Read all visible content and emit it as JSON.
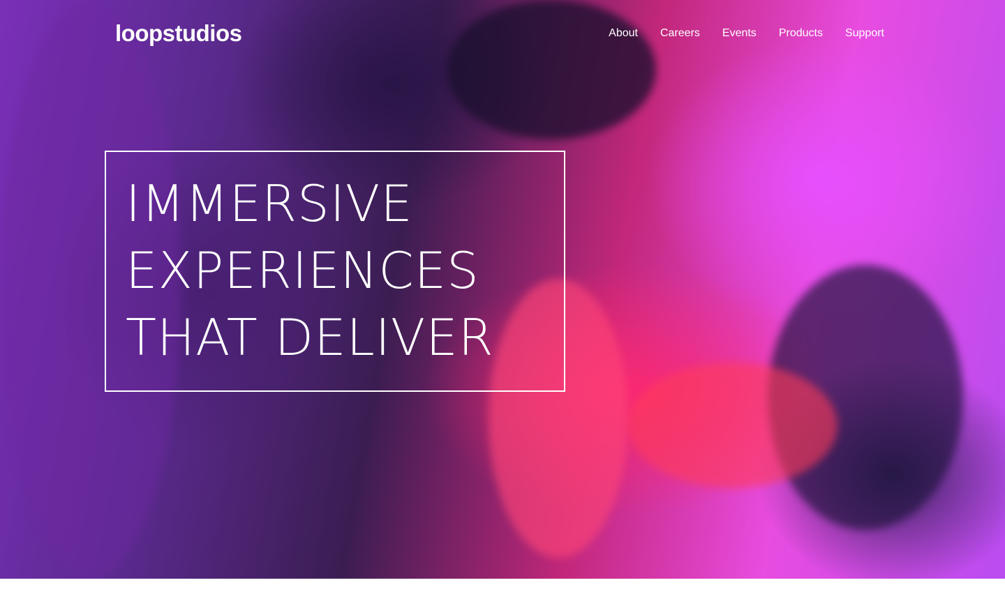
{
  "header": {
    "logo": "loopstudios",
    "nav": [
      "About",
      "Careers",
      "Events",
      "Products",
      "Support"
    ]
  },
  "hero": {
    "headline_lines": [
      "IMMERSIVE",
      "EXPERIENCES",
      "THAT DELIVER"
    ]
  },
  "colors": {
    "text": "#ffffff",
    "hero_purple": "#7a2fb8",
    "hero_magenta": "#e84ce0",
    "hero_red": "#ff2870",
    "page_bg": "#ffffff"
  }
}
